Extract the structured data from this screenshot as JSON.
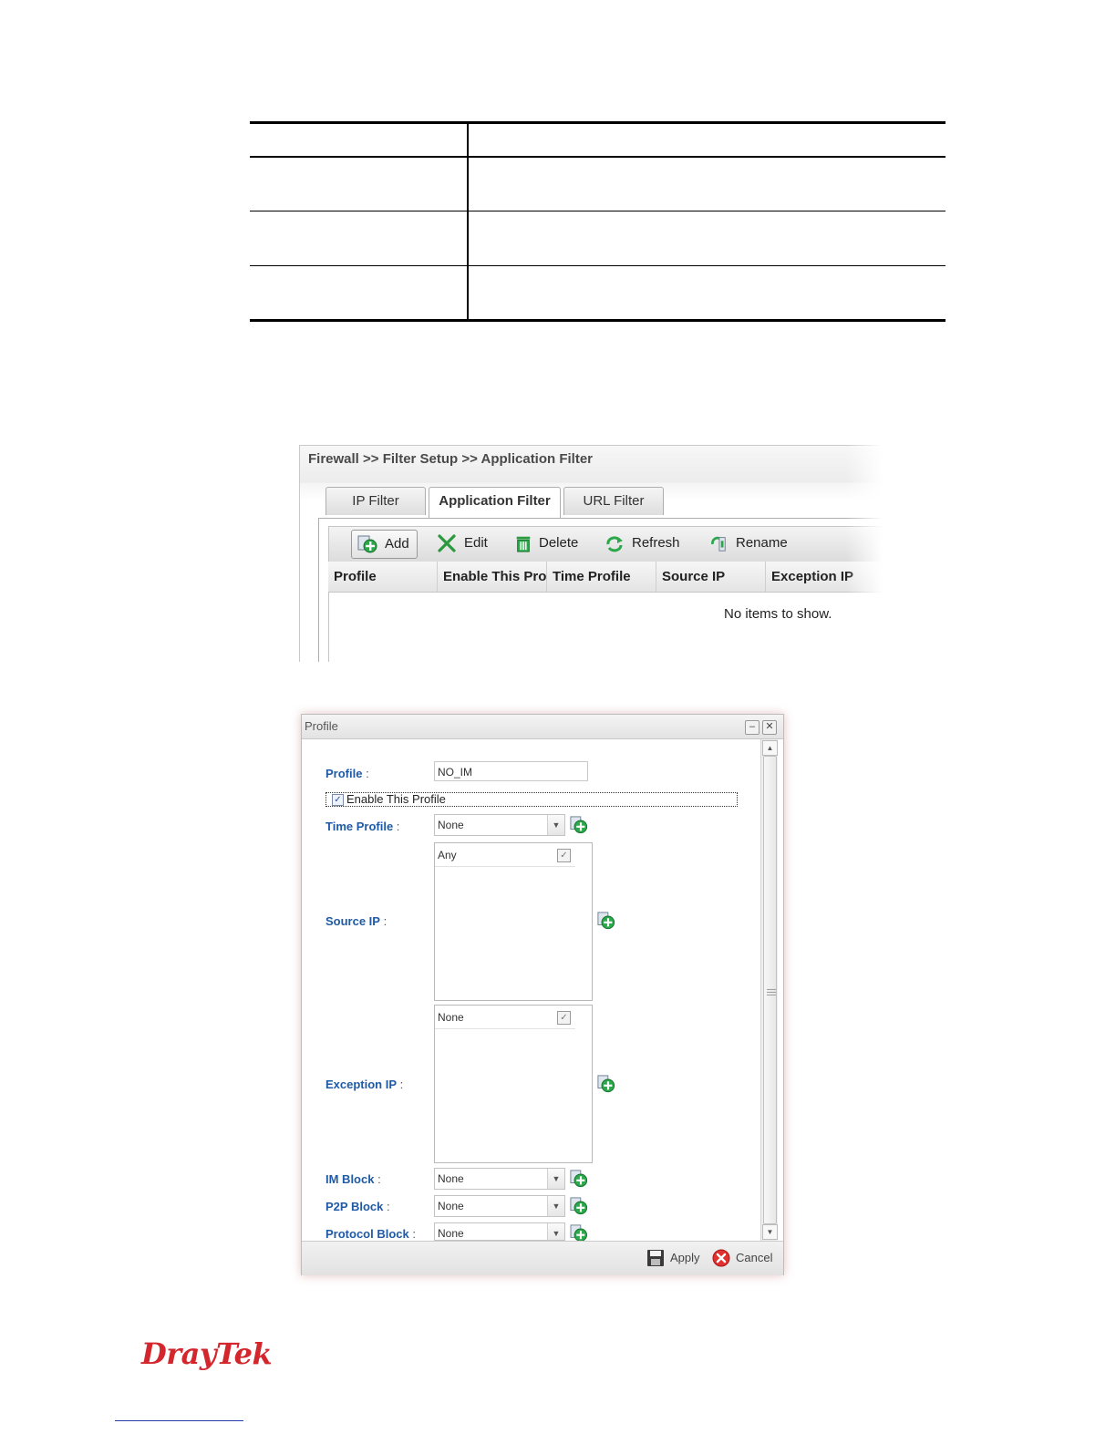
{
  "firewall_page": {
    "breadcrumb": "Firewall >> Filter Setup >> Application Filter",
    "tabs": [
      {
        "label": "IP Filter",
        "active": false
      },
      {
        "label": "Application Filter",
        "active": true
      },
      {
        "label": "URL Filter",
        "active": false
      }
    ],
    "toolbar": {
      "add": "Add",
      "edit": "Edit",
      "delete": "Delete",
      "refresh": "Refresh",
      "rename": "Rename"
    },
    "columns": [
      "Profile",
      "Enable This Pro",
      "Time Profile",
      "Source IP",
      "Exception IP"
    ],
    "empty_message": "No items to show."
  },
  "profile_dialog": {
    "title": "Profile",
    "profile_label": "Profile",
    "profile_value": "NO_IM",
    "enable_label": "Enable This Profile",
    "enable_checked": true,
    "time_profile_label": "Time Profile",
    "time_profile_value": "None",
    "source_ip_label": "Source IP",
    "source_ip_item": "Any",
    "exception_ip_label": "Exception IP",
    "exception_ip_item": "None",
    "im_block_label": "IM Block",
    "im_block_value": "None",
    "p2p_block_label": "P2P Block",
    "p2p_block_value": "None",
    "protocol_block_label": "Protocol Block",
    "protocol_block_value": "None",
    "apply": "Apply",
    "cancel": "Cancel"
  },
  "brand": {
    "logo_text": "DrayTek",
    "color": "#d3262d"
  },
  "colors": {
    "label_blue": "#1f5aa6",
    "add_green": "#2aa84a"
  }
}
